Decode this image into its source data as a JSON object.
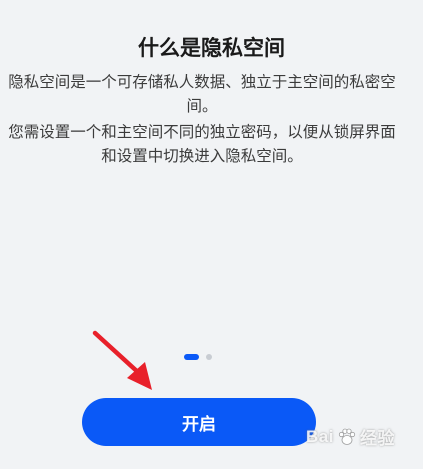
{
  "page": {
    "title": "什么是隐私空间",
    "description_line1": "隐私空间是一个可存储私人数据、独立于主空间的私密空间。",
    "description_line2": "您需设置一个和主空间不同的独立密码，以便从锁屏界面和设置中切换进入隐私空间。"
  },
  "pager": {
    "total": 2,
    "active_index": 0
  },
  "actions": {
    "start_label": "开启"
  },
  "colors": {
    "accent": "#0a59f7",
    "arrow": "#e8202a",
    "background": "#f1f3f5"
  },
  "annotation": {
    "arrow_icon": "red-arrow-icon"
  },
  "watermark": {
    "text_left": "Bai",
    "text_right": "经验"
  }
}
